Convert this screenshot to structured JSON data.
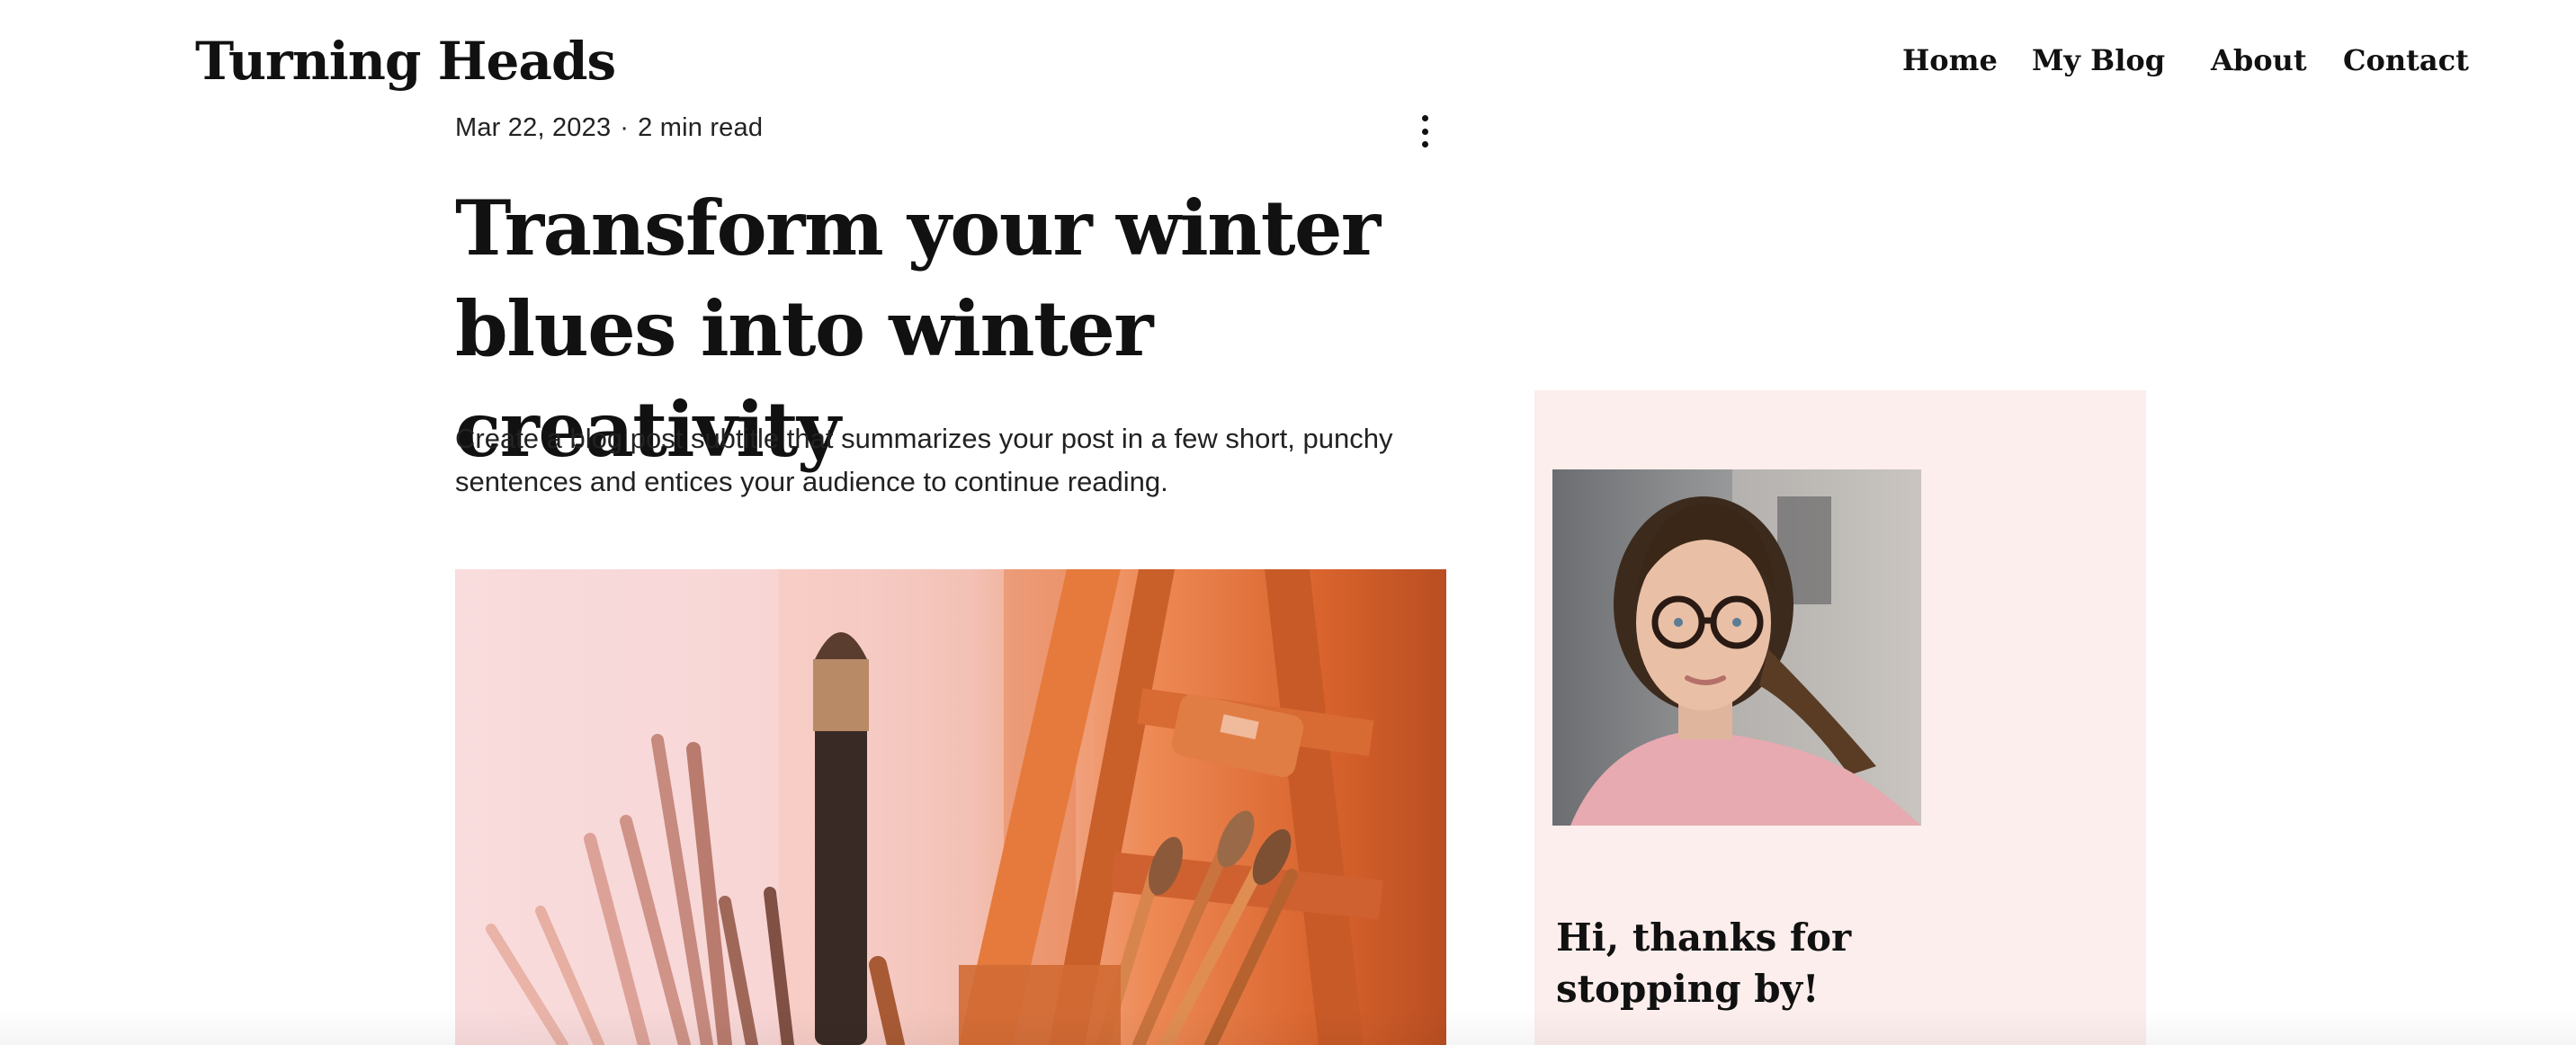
{
  "site": {
    "logo": "Turning Heads"
  },
  "nav": {
    "items": [
      {
        "label": "Home"
      },
      {
        "label": "My Blog"
      },
      {
        "label": "About"
      },
      {
        "label": "Contact"
      }
    ]
  },
  "post": {
    "date": "Mar 22, 2023",
    "separator": "·",
    "read_time": "2 min read",
    "more_icon": "more-vertical-icon",
    "title": "Transform your winter blues into winter creativity",
    "subtitle": "Create a blog post subtitle that summarizes your post in a few short, punchy sentences and entices your audience to continue reading.",
    "hero_image": "paintbrushes-photo"
  },
  "sidebar": {
    "avatar_image": "woman-with-glasses-photo",
    "greeting": "Hi, thanks for stopping by!"
  },
  "colors": {
    "text": "#111111",
    "sidebar_bg": "#fbeeec",
    "hero_pink": "#f9dcdd",
    "hero_orange": "#d8622c"
  }
}
